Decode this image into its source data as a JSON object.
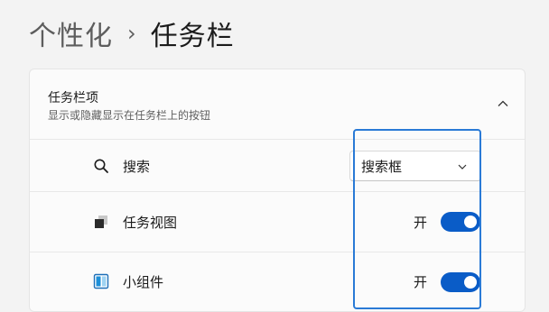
{
  "breadcrumb": {
    "parent": "个性化",
    "separator": "›",
    "current": "任务栏"
  },
  "section": {
    "title": "任务栏项",
    "subtitle": "显示或隐藏显示在任务栏上的按钮",
    "expand_icon": "chevron-up-icon"
  },
  "items": {
    "search": {
      "label": "搜索",
      "icon": "search-icon",
      "selected_option": "搜索框"
    },
    "task_view": {
      "label": "任务视图",
      "icon": "task-view-icon",
      "toggle_label": "开",
      "toggle_on": true
    },
    "widgets": {
      "label": "小组件",
      "icon": "widgets-icon",
      "toggle_label": "开",
      "toggle_on": true
    }
  },
  "colors": {
    "accent": "#0a5cc7",
    "focus": "#2a7ad6",
    "background": "#f3f3f3",
    "card": "#fbfbfb"
  }
}
